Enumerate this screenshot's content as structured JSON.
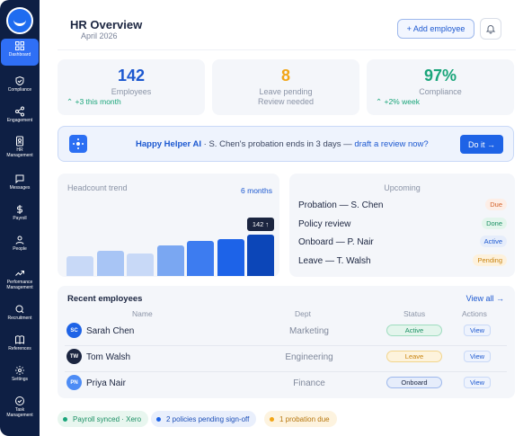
{
  "sidebar": {
    "items": [
      {
        "label": "Dashboard",
        "icon": "dashboard-icon",
        "active": true
      },
      {
        "label": "Compliance",
        "icon": "shield-check-icon"
      },
      {
        "label": "Engagement",
        "icon": "share-icon"
      },
      {
        "label": "HR\nManagement",
        "icon": "id-badge-icon"
      },
      {
        "label": "Messages",
        "icon": "chat-icon"
      },
      {
        "label": "Payroll",
        "icon": "dollar-icon"
      },
      {
        "label": "People",
        "icon": "person-icon"
      },
      {
        "label": "Performance\nManagement",
        "icon": "trend-up-icon"
      },
      {
        "label": "Recruitment",
        "icon": "search-icon"
      },
      {
        "label": "References",
        "icon": "book-icon"
      },
      {
        "label": "Settings",
        "icon": "gear-icon"
      },
      {
        "label": "Task\nManagement",
        "icon": "check-circle-icon"
      }
    ]
  },
  "header": {
    "title": "HR Overview",
    "subtitle": "April 2026",
    "add_button": "+ Add employee",
    "bell_icon": "bell-icon"
  },
  "stats": [
    {
      "value": "142",
      "label": "Employees",
      "delta": "+3 this month",
      "color": "#1c58d0"
    },
    {
      "value": "8",
      "label": "Leave pending",
      "note": "Review needed",
      "color": "#f2a516"
    },
    {
      "value": "97%",
      "label": "Compliance",
      "delta": "+2% week",
      "color": "#1aa57a"
    }
  ],
  "helper": {
    "brand": "Happy Helper AI",
    "text": " · S. Chen's probation ends in 3 days — ",
    "link": "draft a review now?",
    "button": "Do it →"
  },
  "trend": {
    "title": "Headcount trend",
    "range": "6 months",
    "tooltip": "142 ↑",
    "levels": [
      0.28,
      0.37,
      0.33,
      0.45,
      0.52,
      0.55
    ],
    "bar_colors": [
      "#c8d9f7",
      "#a8c5f5",
      "#c8d9f7",
      "#7aa7f2",
      "#3d7cf0",
      "#1d63e8",
      "#0c46b8"
    ]
  },
  "upcoming": {
    "title": "Upcoming",
    "items": [
      {
        "name": "Probation — S. Chen",
        "status": "Due",
        "bg": "#fdeee6",
        "fg": "#d4622a"
      },
      {
        "name": "Policy review",
        "status": "Done",
        "bg": "#e3f5ec",
        "fg": "#1a8f63"
      },
      {
        "name": "Onboard — P. Nair",
        "status": "Active",
        "bg": "#e6edfb",
        "fg": "#1c58d0"
      },
      {
        "name": "Leave — T. Walsh",
        "status": "Pending",
        "bg": "#fdf1dc",
        "fg": "#c98410"
      }
    ]
  },
  "employees": {
    "title": "Recent employees",
    "view_all": "View all →",
    "columns": [
      "Name",
      "Dept",
      "Status",
      "Actions"
    ],
    "rows": [
      {
        "initials": "SC",
        "name": "Sarah Chen",
        "dept": "Marketing",
        "status": "Active",
        "action": "View",
        "avatar": "#1e63e6",
        "bg": "#e3f5ec",
        "fg": "#1a8f63",
        "border": "#9edcbf"
      },
      {
        "initials": "TW",
        "name": "Tom Walsh",
        "dept": "Engineering",
        "status": "Leave",
        "action": "View",
        "avatar": "#1b2540",
        "bg": "#fdf3dc",
        "fg": "#c98410",
        "border": "#f2d58c"
      },
      {
        "initials": "PN",
        "name": "Priya Nair",
        "dept": "Finance",
        "status": "Onboard",
        "action": "View",
        "avatar": "#4d8cf5",
        "bg": "#e6edfb",
        "fg": "#1b2540",
        "border": "#9db8ec"
      }
    ]
  },
  "chips": [
    {
      "label": "Payroll synced · Xero",
      "dot": "#1aa57a",
      "bg": "#e8f6ef",
      "fg": "#1a8f63"
    },
    {
      "label": "2 policies pending sign-off",
      "dot": "#1e63e6",
      "bg": "#e9effc",
      "fg": "#1c4fb8"
    },
    {
      "label": "1 probation due",
      "dot": "#f2a516",
      "bg": "#fdf3df",
      "fg": "#b7770e"
    }
  ]
}
